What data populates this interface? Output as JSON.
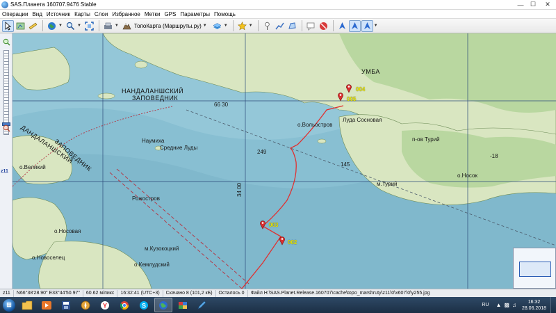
{
  "window": {
    "title": "SAS.Планета 160707.9476 Stable",
    "minimize_icon": "minimize-icon",
    "maximize_icon": "maximize-icon",
    "close_icon": "close-icon"
  },
  "menu": {
    "items": [
      "Операции",
      "Вид",
      "Источник",
      "Карты",
      "Слои",
      "Избранное",
      "Метки",
      "GPS",
      "Параметры",
      "Помощь"
    ]
  },
  "toolbar": {
    "map_type_label": "ТопоКарта (Маршруты.ру)",
    "icons": [
      "cursor-icon",
      "map-move-icon",
      "ruler-icon",
      "globe-icon",
      "zoom-icon",
      "fullscreen-icon",
      "map-source-icon",
      "topo-map-icon",
      "layers-icon",
      "star-icon",
      "placemark-icon",
      "path-icon",
      "polygon-icon",
      "label-icon",
      "stop-icon",
      "gps-icon",
      "gps-follow-icon",
      "gps-track-icon"
    ]
  },
  "zoom": {
    "level": "z11"
  },
  "map": {
    "labels": {
      "reserve_line1": "НАНДАЛАНШСКИЙ",
      "reserve_line2": "ЗАПОВЕДНИК",
      "reserve_left1": "ДАНДАЛАНШСКИЙ",
      "reserve_left2": "ЗАПОВЕДНИК",
      "umba": "УМБА",
      "vel": "о.Вольостров",
      "sredn": "Средние Луды",
      "naumiha": "Наумиха",
      "velikiy": "о.Великий",
      "nosovaya": "о.Носовая",
      "pezhostrov": "Рожостров",
      "kuzokotsky": "м.Кузокоцкий",
      "novoselets": "о.Новоселец",
      "kemludsky": "о.Кемлудский",
      "turiy": "п-ов Турий",
      "turiy_cape": "м.Турий",
      "nosok": "о.Носок",
      "depth_249": "249",
      "depth_145": "145",
      "depth_34": "34 00",
      "depth_66": "66 30",
      "fish": "Луда Сосновая",
      "pilot": "-18"
    },
    "waypoints": [
      "002",
      "003",
      "004",
      "005"
    ],
    "colors": {
      "sea": "#94c7d8",
      "land": "#d9e6c1",
      "forest": "#b9d7a0",
      "track": "#e03030"
    }
  },
  "status": {
    "zoom": "z11",
    "coords": "N66°38'28.90\" E33°44'50.97\"",
    "scale": "60.62 м/пикс",
    "time": "16:32:41 (UTC+3)",
    "downloaded": "Скачано 8 (101,2 кБ)",
    "remaining": "Осталось 0",
    "file": "Файл H:\\SAS.Planet.Release.160707\\cache\\topo_marshruty\\z11\\0\\x607\\0\\y255.jpg"
  },
  "taskbar": {
    "apps": [
      "start-icon",
      "explorer-icon",
      "media-icon",
      "save-icon",
      "compass-icon",
      "yandex-icon",
      "chrome-icon",
      "skype-icon",
      "sasplanet-icon",
      "puzzle-icon",
      "draw-icon"
    ],
    "lang": "RU",
    "time": "16:32",
    "date": "28.06.2018"
  }
}
